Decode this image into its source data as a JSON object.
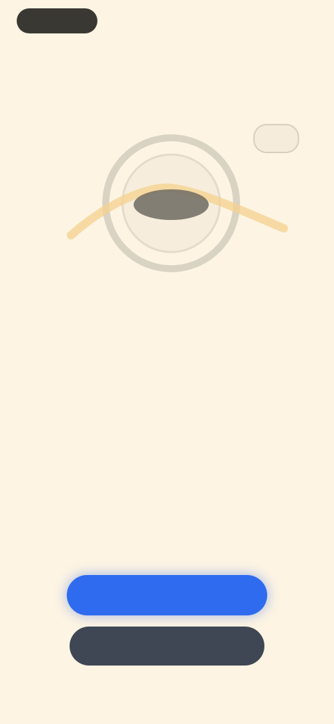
{
  "status_bar": {
    "left_label": "",
    "right_label": ""
  },
  "illustration": {
    "badge_text": "",
    "center_text": ""
  },
  "content": {
    "headline": "",
    "body": "",
    "footnote": ""
  },
  "actions": {
    "primary_label": "",
    "secondary_label": ""
  },
  "colors": {
    "background": "#fdf4e3",
    "primary_button": "#2f6bef",
    "secondary_button": "#3f4754",
    "pill": "#3a3833"
  }
}
